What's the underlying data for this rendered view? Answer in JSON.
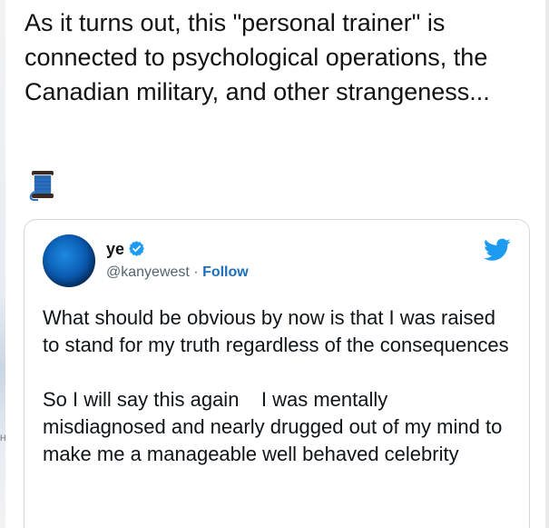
{
  "post": {
    "text": "As it turns out, this \"personal trainer\" is connected to psychological operations, the Canadian military, and other strangeness...",
    "emoji": "spool-of-thread"
  },
  "edge": {
    "marker": "H"
  },
  "embed": {
    "author": {
      "name": "ye",
      "handle": "@kanyewest",
      "separator": " · ",
      "follow_label": "Follow",
      "verified": true
    },
    "brand_icon": "twitter-bird-icon",
    "brand_color": "#1d9bf0",
    "tweet_text": "What should be obvious by now is that I was raised to stand for my truth regardless of the consequences\n\nSo I will say this again    I was mentally misdiagnosed and nearly drugged out of my mind to make me a manageable well behaved celebrity"
  },
  "colors": {
    "text": "#0f1419",
    "secondary": "#536471",
    "link": "#1d6fb8",
    "border": "#cfd9de",
    "verified": "#1d9bf0"
  }
}
